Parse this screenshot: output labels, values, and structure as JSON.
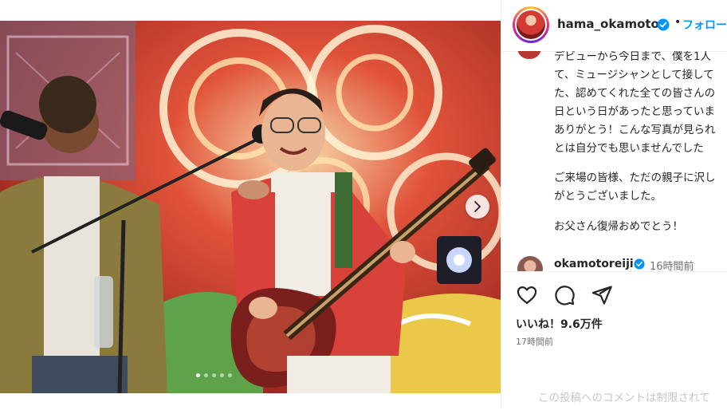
{
  "post": {
    "username": "hama_okamoto",
    "follow_label": "フォロー",
    "separator": "•",
    "caption_lines": [
      "デビューから今日まで、僕を1人",
      "て、ミュージシャンとして接して",
      "た、認めてくれた全ての皆さんの",
      "日という日があったと思っていま",
      "ありがとう！こんな写真が見られ",
      "とは自分でも思いませんでした",
      "",
      "ご来場の皆様、ただの親子に沢し",
      "がとうございました。",
      "",
      "お父さん復帰おめでとう！"
    ],
    "comment": {
      "username": "okamotoreiji",
      "time": "16時間前"
    },
    "likes": "いいね！9.6万件",
    "posted": "17時間前",
    "restricted_text": "この投稿へのコメントは制限されて"
  },
  "icons": {
    "verified": "verified-badge-icon",
    "like": "heart-icon",
    "comment": "comment-icon",
    "share": "share-icon",
    "next": "chevron-right-icon"
  },
  "colors": {
    "link": "#0095f6",
    "verified": "#0095f6",
    "text": "#262626",
    "muted": "#737373"
  },
  "carousel": {
    "slide_count": 5,
    "active_index": 0
  }
}
